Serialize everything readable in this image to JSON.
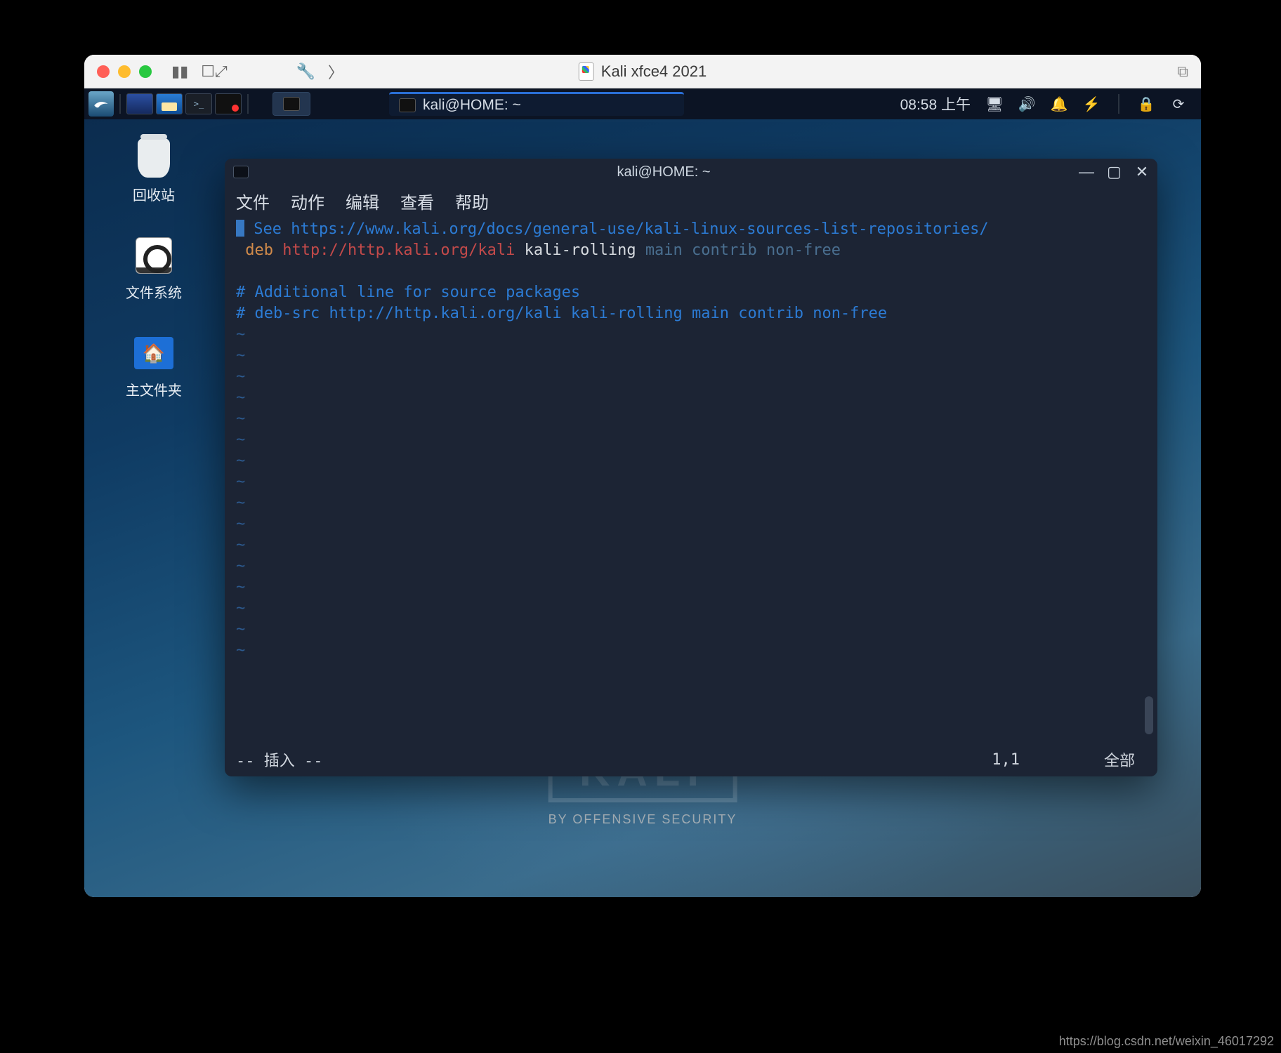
{
  "mac": {
    "title": "Kali xfce4 2021"
  },
  "panel": {
    "task_active_label": "kali@HOME: ~",
    "clock": "08:58 上午"
  },
  "desktop": {
    "trash": "回收站",
    "filesystem": "文件系统",
    "home": "主文件夹"
  },
  "watermark": {
    "word": "KALI",
    "sub": "BY OFFENSIVE SECURITY"
  },
  "terminal": {
    "title": "kali@HOME: ~",
    "menu": [
      "文件",
      "动作",
      "编辑",
      "查看",
      "帮助"
    ],
    "lines": {
      "l1_comment": " See https://www.kali.org/docs/general-use/kali-linux-sources-list-repositories/",
      "l2_key": " deb ",
      "l2_url": "http://http.kali.org/kali",
      "l2_white": " kali-rolling ",
      "l2_opt": "main contrib non-free",
      "l3": "",
      "l4": "# Additional line for source packages",
      "l5": "# deb-src http://http.kali.org/kali kali-rolling main contrib non-free"
    },
    "status_mode": "-- 插入 --",
    "status_pos": "1,1",
    "status_scope": "全部"
  },
  "page_watermark": "https://blog.csdn.net/weixin_46017292"
}
